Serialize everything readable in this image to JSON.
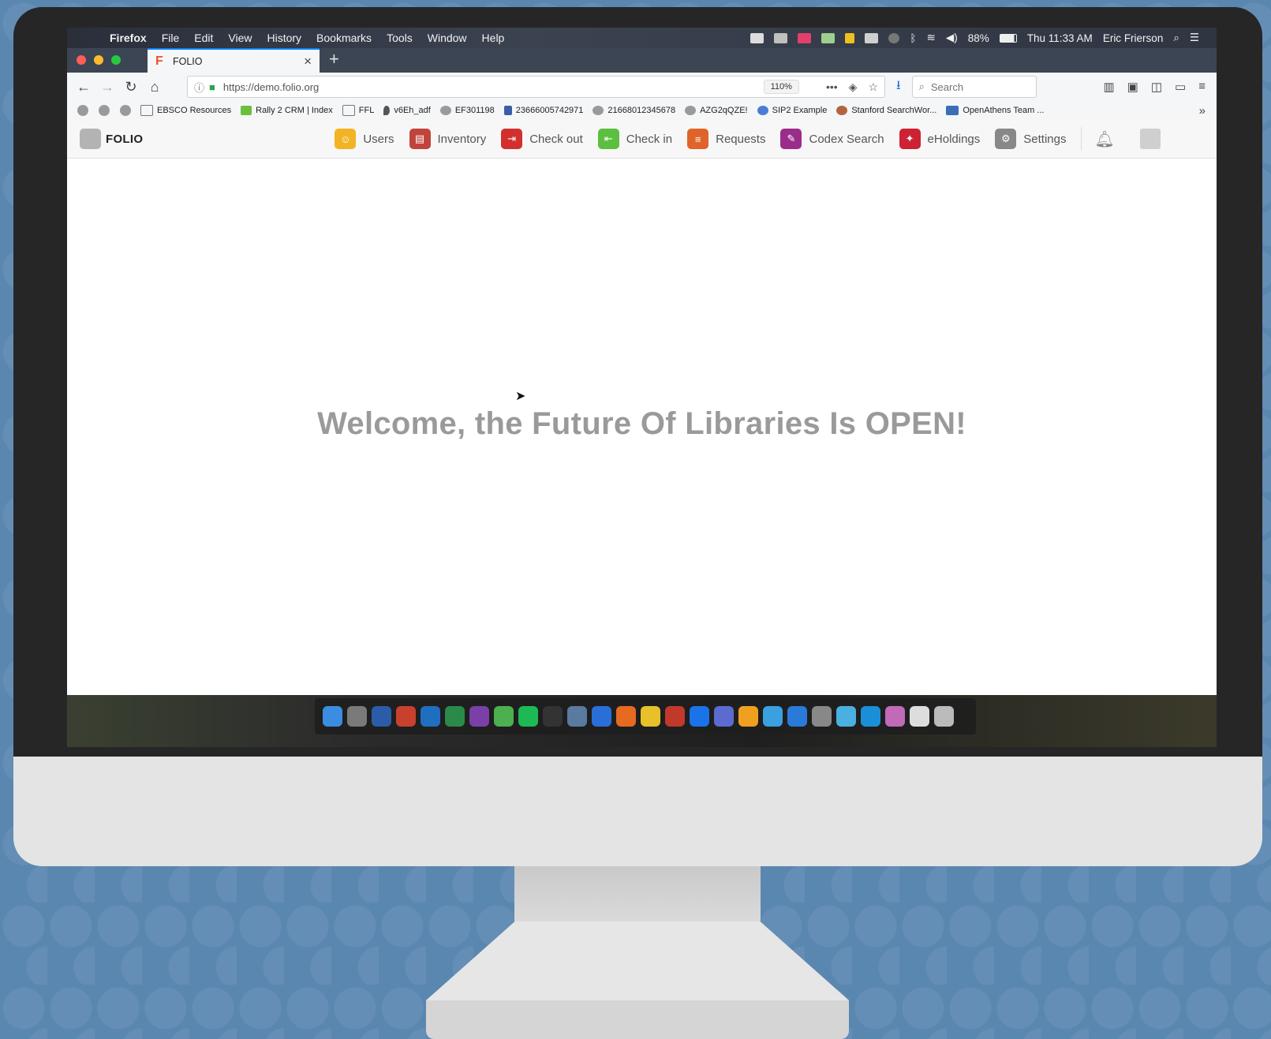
{
  "menubar": {
    "app_name": "Firefox",
    "items": [
      "File",
      "Edit",
      "View",
      "History",
      "Bookmarks",
      "Tools",
      "Window",
      "Help"
    ],
    "battery": "88%",
    "clock": "Thu 11:33 AM",
    "user": "Eric Frierson"
  },
  "tab": {
    "title": "FOLIO",
    "favicon": "F"
  },
  "navbar": {
    "url": "https://demo.folio.org",
    "zoom": "110%",
    "search_placeholder": "Search"
  },
  "bookmarks": [
    {
      "label": "EBSCO Resources",
      "icon": "folder-icon",
      "color": "#8a8a8a"
    },
    {
      "label": "Rally 2 CRM | Index",
      "icon": "rally-icon",
      "color": "#6bbf3f"
    },
    {
      "label": "FFL",
      "icon": "folder-icon",
      "color": "#8a8a8a"
    },
    {
      "label": "v6Eh_adf",
      "icon": "pin-icon",
      "color": "#555555"
    },
    {
      "label": "EF301198",
      "icon": "globe-icon",
      "color": "#8a8a8a"
    },
    {
      "label": "23666005742971",
      "icon": "e-icon",
      "color": "#3a5fa8"
    },
    {
      "label": "21668012345678",
      "icon": "globe-icon",
      "color": "#8a8a8a"
    },
    {
      "label": "AZG2qQZE!",
      "icon": "globe-icon",
      "color": "#8a8a8a"
    },
    {
      "label": "SIP2 Example",
      "icon": "sip-icon",
      "color": "#4a7bd6"
    },
    {
      "label": "Stanford SearchWor...",
      "icon": "stanford-icon",
      "color": "#b5633f"
    },
    {
      "label": "OpenAthens Team ...",
      "icon": "fa-icon",
      "color": "#3a6fb8"
    }
  ],
  "folio": {
    "logo_text": "FOLIO",
    "apps": [
      {
        "label": "Users",
        "color": "#f2b424",
        "glyph": "☺"
      },
      {
        "label": "Inventory",
        "color": "#c0443c",
        "glyph": "▤"
      },
      {
        "label": "Check out",
        "color": "#d22f2f",
        "glyph": "⇥"
      },
      {
        "label": "Check in",
        "color": "#5cbf3f",
        "glyph": "⇤"
      },
      {
        "label": "Requests",
        "color": "#e0642a",
        "glyph": "≡"
      },
      {
        "label": "Codex Search",
        "color": "#9b2d8a",
        "glyph": "✎"
      },
      {
        "label": "eHoldings",
        "color": "#cc2233",
        "glyph": "✦"
      },
      {
        "label": "Settings",
        "color": "#888888",
        "glyph": "⚙"
      }
    ]
  },
  "content": {
    "welcome": "Welcome, the Future Of Libraries Is OPEN!"
  },
  "dock": [
    "#3a8de0",
    "#7a7a7a",
    "#2b5ca8",
    "#c8412f",
    "#1f6fc0",
    "#2a8a4a",
    "#7b3fa8",
    "#4caf50",
    "#1db954",
    "#333333",
    "#5a7aa0",
    "#2a6fd8",
    "#e66a1f",
    "#e8c02a",
    "#c0392b",
    "#1a73e8",
    "#5b6bd0",
    "#f0a020",
    "#3aa0e0",
    "#2a7ad8",
    "#888888",
    "#4ab0e0",
    "#1a8fd8",
    "#c06ab8",
    "#dddddd",
    "#bbbbbb"
  ]
}
